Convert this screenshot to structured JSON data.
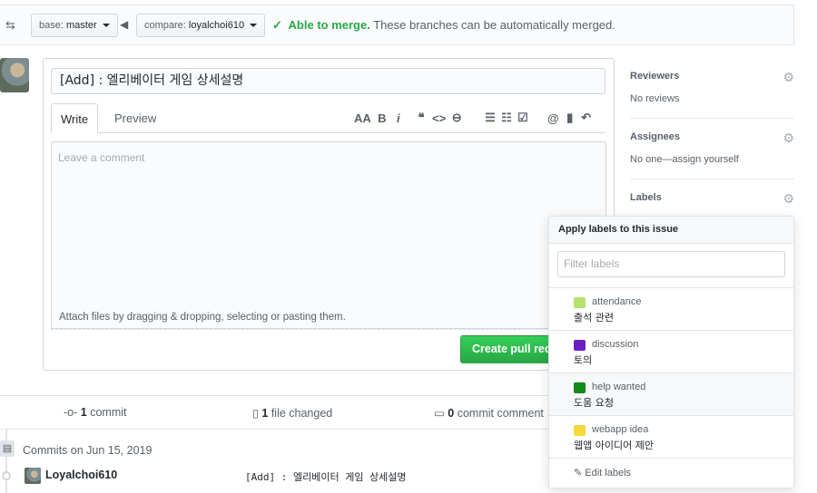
{
  "compare_bar": {
    "base_prefix": "base:",
    "base_value": "master",
    "compare_prefix": "compare:",
    "compare_value": "loyalchoi610",
    "status_strong": "Able to merge.",
    "status_text": "These branches can be automatically merged."
  },
  "form": {
    "title_value": "[Add] : 엘리베이터 게임 상세설명",
    "tabs": [
      "Write",
      "Preview"
    ],
    "comment_placeholder": "Leave a comment",
    "attach_text": "Attach files by dragging & dropping, selecting or pasting them.",
    "create_button": "Create pull request"
  },
  "toolbar": {
    "header": "AA",
    "bold": "B",
    "italic": "i",
    "quote": "❝",
    "code": "<>",
    "link": "⊖",
    "bullets": "☰",
    "numbered": "☷",
    "tasks": "☑",
    "mention": "@",
    "bookmark": "▮",
    "reply": "↶"
  },
  "sidebar": {
    "reviewers_heading": "Reviewers",
    "reviewers_value": "No reviews",
    "assignees_heading": "Assignees",
    "assignees_value": "No one—assign yourself",
    "labels_heading": "Labels"
  },
  "summary": {
    "commits_count": "1",
    "commits_label": "commit",
    "files_count": "1",
    "files_label": "file changed",
    "comments_count": "0",
    "comments_label": "commit comment"
  },
  "commits": {
    "group_label": "Commits on Jun 15, 2019",
    "author": "Loyalchoi610",
    "message": "[Add] : 엘리베이터 게임 상세설명"
  },
  "label_popover": {
    "header": "Apply labels to this issue",
    "filter_placeholder": "Filter labels",
    "labels": [
      {
        "name": "attendance",
        "desc": "출석 관련",
        "color": "#b4e36f"
      },
      {
        "name": "discussion",
        "desc": "토의",
        "color": "#6a1fc2"
      },
      {
        "name": "help wanted",
        "desc": "도움 요청",
        "color": "#118a16"
      },
      {
        "name": "webapp idea",
        "desc": "웹앱 아이디어 제안",
        "color": "#f7d93a"
      }
    ],
    "edit_labels": "Edit labels"
  }
}
